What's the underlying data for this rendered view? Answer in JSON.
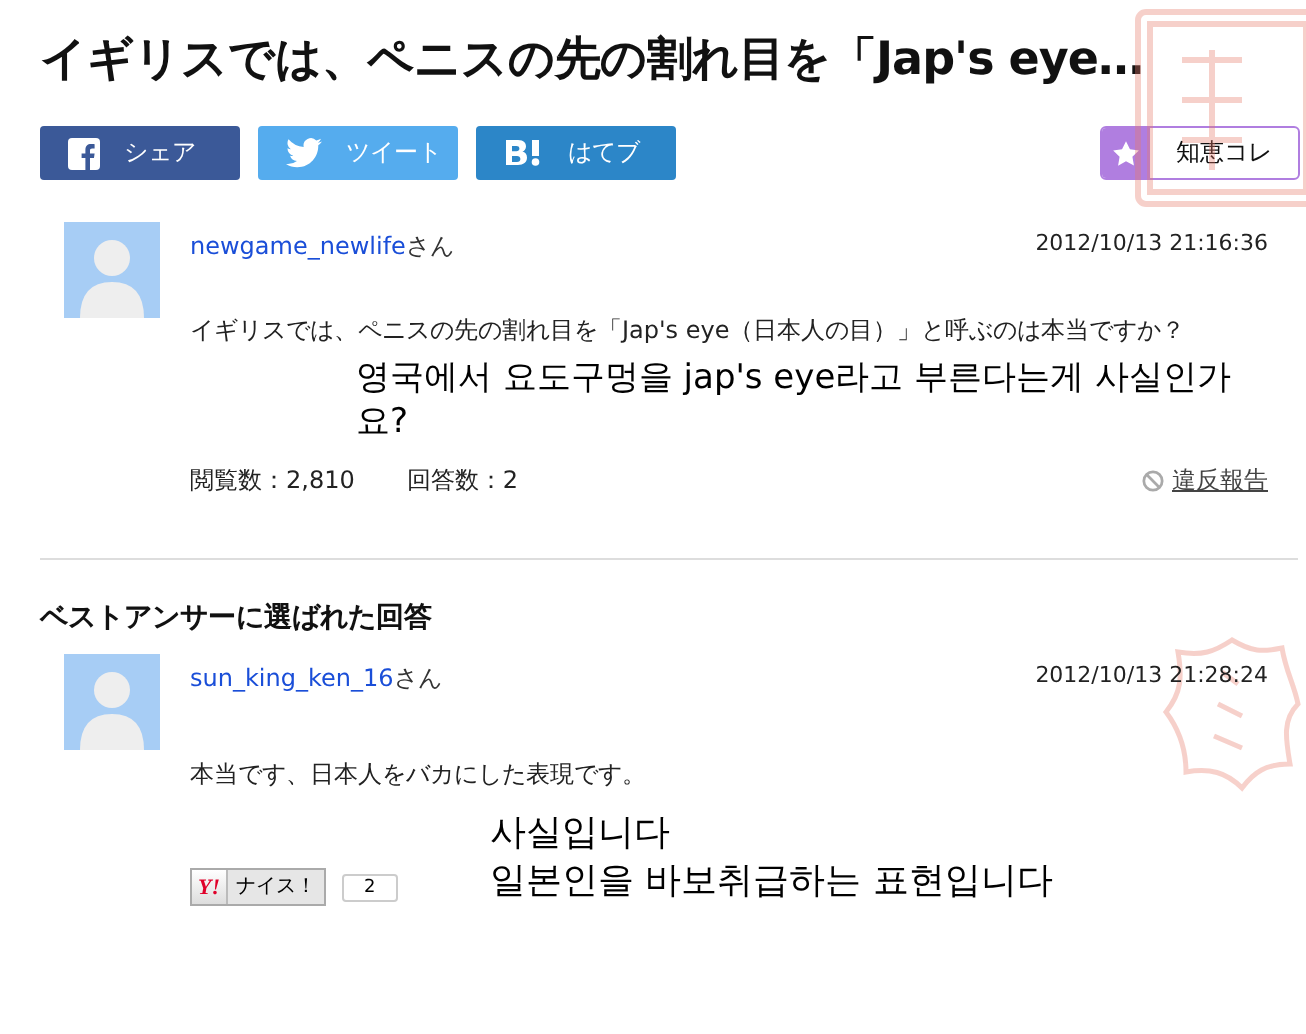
{
  "title": "イギリスでは、ペニスの先の割れ目を「Jap's eye…",
  "share_buttons": [
    {
      "kind": "facebook",
      "label": "シェア"
    },
    {
      "kind": "twitter",
      "label": "ツイート"
    },
    {
      "kind": "hatena",
      "label": "はてブ"
    }
  ],
  "chiebukuro_button": {
    "label": "知恵コレ"
  },
  "question": {
    "user": "newgame_newlife",
    "honorific": "さん",
    "time": "2012/10/13  21:16:36",
    "text": "イギリスでは、ペニスの先の割れ目を「Jap's eye（日本人の目）」と呼ぶのは本当ですか？",
    "overlay": "영국에서 요도구멍을 jap's eye라고 부른다는게 사실인가요?",
    "views": "閲覧数：2,810",
    "answers": "回答数：2",
    "report": "違反報告"
  },
  "best_answer": {
    "heading": "ベストアンサーに選ばれた回答",
    "user": "sun_king_ken_16",
    "honorific": "さん",
    "time": "2012/10/13  21:28:24",
    "text": "本当です、日本人をバカにした表現です。",
    "overlay": [
      "사실입니다",
      "일본인을 바보취급하는 표현입니다"
    ],
    "nice_label": "ナイス！",
    "nice_logo": "Y!",
    "nice_count": "2"
  }
}
